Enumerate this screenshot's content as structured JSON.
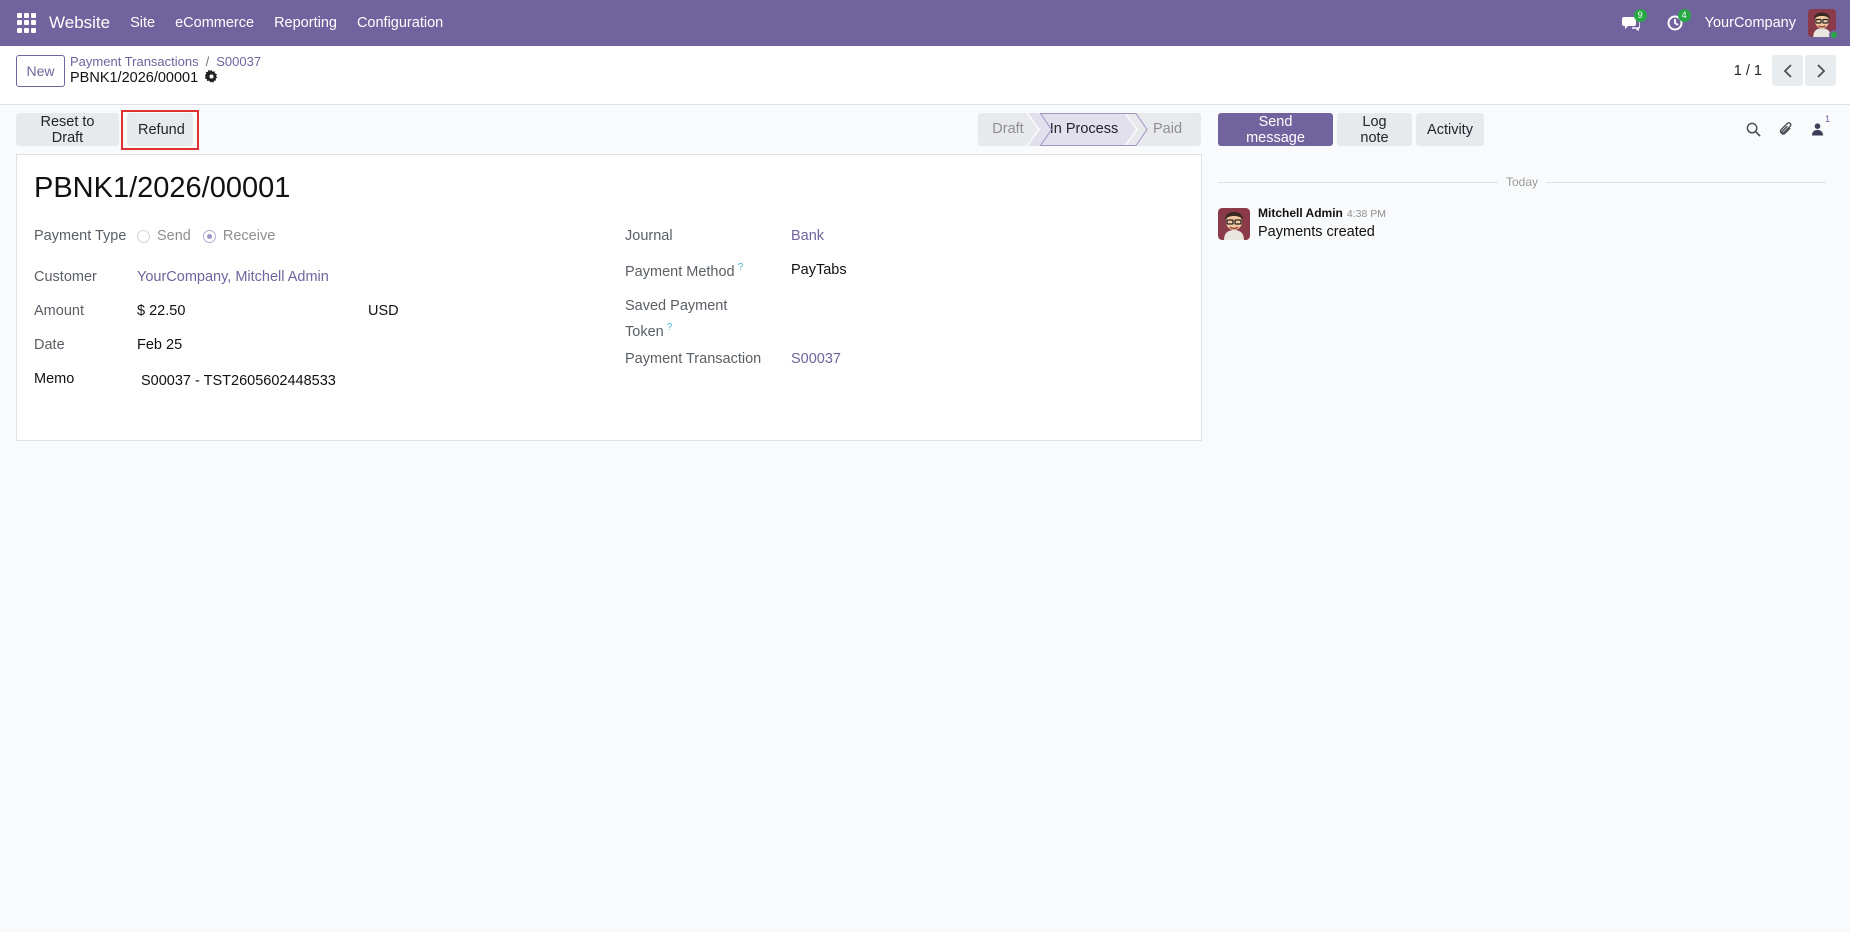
{
  "navbar": {
    "app_name": "Website",
    "menu": [
      "Site",
      "eCommerce",
      "Reporting",
      "Configuration"
    ],
    "messages_count": "9",
    "activities_count": "4",
    "company": "YourCompany"
  },
  "control_panel": {
    "new_label": "New",
    "breadcrumb": [
      "Payment Transactions",
      "S00037"
    ],
    "breadcrumb_separator": "/",
    "record_name": "PBNK1/2026/00001",
    "pager": "1 / 1"
  },
  "statusbar": {
    "buttons": {
      "reset": "Reset to Draft",
      "refund": "Refund"
    },
    "stages": [
      "Draft",
      "In Process",
      "Paid"
    ],
    "active_stage": "In Process"
  },
  "form": {
    "title": "PBNK1/2026/00001",
    "payment_type": {
      "label": "Payment Type",
      "options": [
        "Send",
        "Receive"
      ],
      "selected": "Receive"
    },
    "customer": {
      "label": "Customer",
      "value": "YourCompany, Mitchell Admin"
    },
    "amount": {
      "label": "Amount",
      "value": "$ 22.50",
      "currency": "USD"
    },
    "date": {
      "label": "Date",
      "value": "Feb 25"
    },
    "memo": {
      "label": "Memo",
      "value": "S00037 - TST2605602448533"
    },
    "journal": {
      "label": "Journal",
      "value": "Bank"
    },
    "payment_method": {
      "label": "Payment Method",
      "help": "?",
      "value": "PayTabs"
    },
    "saved_token": {
      "label_line1": "Saved Payment",
      "label_line2": "Token",
      "help": "?"
    },
    "payment_transaction": {
      "label": "Payment Transaction",
      "value": "S00037"
    }
  },
  "chatter": {
    "buttons": {
      "send": "Send message",
      "log": "Log note",
      "activity": "Activity"
    },
    "followers_count": "1",
    "date_separator": "Today",
    "message": {
      "author": "Mitchell Admin",
      "time": "4:38 PM",
      "body": "Payments created"
    }
  },
  "colors": {
    "brand": "#71639e",
    "highlight": "#e03131",
    "badge": "#28a745"
  }
}
